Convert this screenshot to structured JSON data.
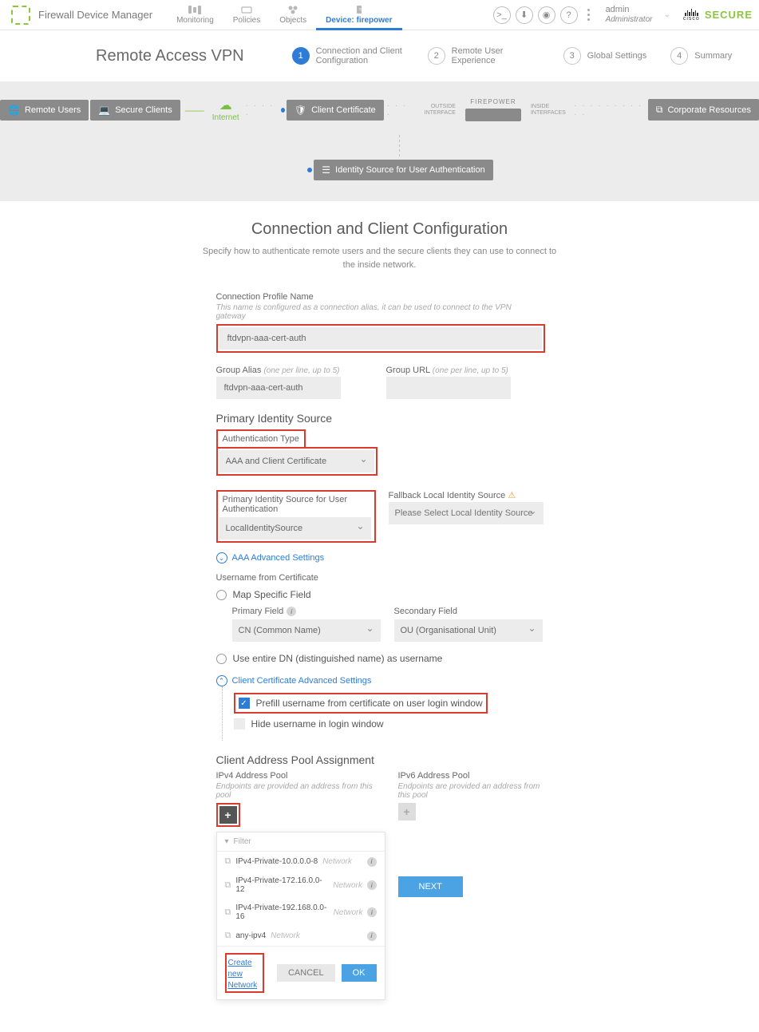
{
  "brand": "Firewall Device Manager",
  "nav": {
    "monitoring": "Monitoring",
    "policies": "Policies",
    "objects": "Objects",
    "device_prefix": "Device:",
    "device_name": "firepower"
  },
  "user": {
    "name": "admin",
    "role": "Administrator"
  },
  "cisco": {
    "secure": "SECURE",
    "cisco": "cisco"
  },
  "page_title": "Remote Access VPN",
  "steps": {
    "s1": "Connection and Client Configuration",
    "s2": "Remote User Experience",
    "s3": "Global Settings",
    "s4": "Summary"
  },
  "diagram": {
    "remote_users": "Remote Users",
    "secure_clients": "Secure Clients",
    "internet": "Internet",
    "client_cert": "Client Certificate",
    "outside": "OUTSIDE INTERFACE",
    "inside": "INSIDE INTERFACES",
    "firepower": "FIREPOWER",
    "corp": "Corporate Resources",
    "identity_src": "Identity Source for User Authentication"
  },
  "main": {
    "heading": "Connection and Client Configuration",
    "subtitle": "Specify how to authenticate remote users and the secure clients they can use to connect to the inside network.",
    "conn_profile_label": "Connection Profile Name",
    "conn_profile_hint": "This name is configured as a connection alias, it can be used to connect to the VPN gateway",
    "conn_profile_value": "ftdvpn-aaa-cert-auth",
    "group_alias_label": "Group Alias",
    "group_alias_hint": "(one per line, up to 5)",
    "group_alias_value": "ftdvpn-aaa-cert-auth",
    "group_url_label": "Group URL",
    "group_url_hint": "(one per line, up to 5)",
    "primary_identity_heading": "Primary Identity Source",
    "auth_type_label": "Authentication Type",
    "auth_type_value": "AAA and Client Certificate",
    "primary_src_label": "Primary Identity Source for User Authentication",
    "primary_src_value": "LocalIdentitySource",
    "fallback_label": "Fallback Local Identity Source",
    "fallback_placeholder": "Please Select Local Identity Source",
    "aaa_advanced": "AAA Advanced Settings",
    "username_cert_label": "Username from Certificate",
    "map_specific": "Map Specific Field",
    "primary_field_label": "Primary Field",
    "primary_field_value": "CN (Common Name)",
    "secondary_field_label": "Secondary Field",
    "secondary_field_value": "OU (Organisational Unit)",
    "use_entire_dn": "Use entire DN (distinguished name) as username",
    "client_cert_adv": "Client Certificate Advanced Settings",
    "prefill": "Prefill username from certificate on user login window",
    "hide_username": "Hide username in login window",
    "client_pool_heading": "Client Address Pool Assignment",
    "ipv4_pool_label": "IPv4 Address Pool",
    "ipv6_pool_label": "IPv6 Address Pool",
    "pool_hint": "Endpoints are provided an address from this pool",
    "filter": "Filter",
    "network_type": "Network",
    "pool_items": {
      "p1": "IPv4-Private-10.0.0.0-8",
      "p2": "IPv4-Private-172.16.0.0-12",
      "p3": "IPv4-Private-192.168.0.0-16",
      "p4": "any-ipv4"
    },
    "create_new": "Create new Network",
    "cancel": "CANCEL",
    "ok": "OK",
    "next": "NEXT"
  }
}
